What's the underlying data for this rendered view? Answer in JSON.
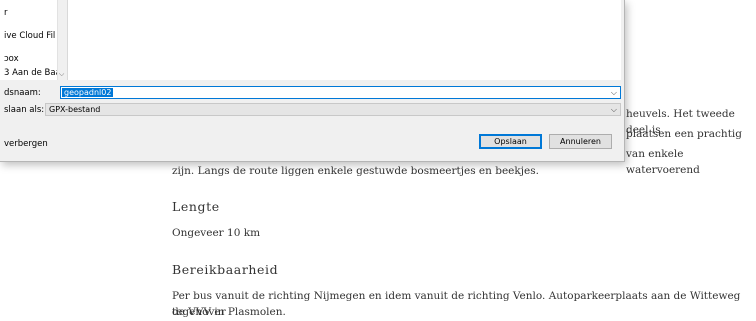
{
  "page": {
    "paragraph1_line1_tail": "heuvels. Het tweede deel is",
    "paragraph1_line2_tail": "plaatsen een prachtig",
    "paragraph1_line3_tail": "van enkele watervoerend",
    "paragraph1_line4": "zijn. Langs de route liggen enkele gestuwde bosmeertjes en beekjes.",
    "section_length_heading": "Lengte",
    "section_length_text": "Ongeveer 10 km",
    "section_access_heading": "Bereikbaarheid",
    "section_access_line1": "Per bus vanuit de richting Nijmegen en idem vanuit de richting Venlo. Autoparkeerplaats aan de Witteweg tegenover",
    "section_access_line2": "de VVV in Plasmolen."
  },
  "dialog": {
    "nav_items": [
      "r",
      "ive Cloud Fil",
      "ɔox",
      "3 Aan de Baa"
    ],
    "filename_label": "dsnaam:",
    "filename_value": "geopadnl02",
    "filetype_label": "slaan als:",
    "filetype_value": "GPX-bestand",
    "hide_folders_label": "verbergen",
    "save_button": "Opslaan",
    "cancel_button": "Annuleren",
    "chevron_glyph": "⌵"
  }
}
